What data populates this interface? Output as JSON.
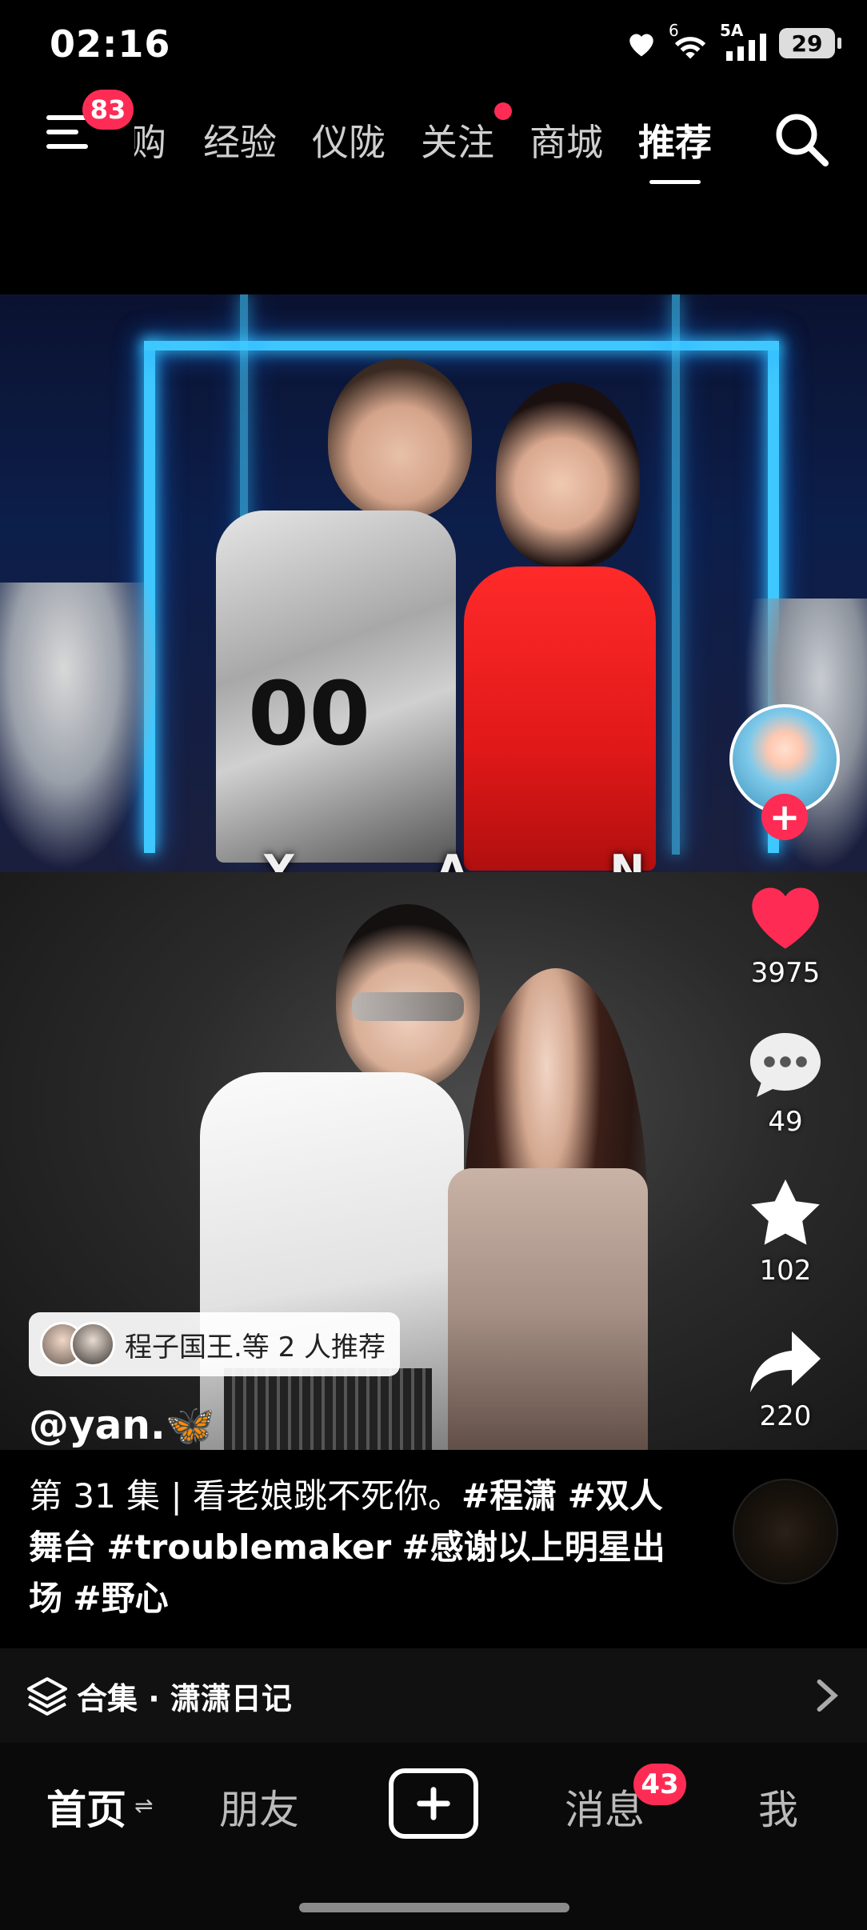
{
  "status_bar": {
    "time": "02:16",
    "network_small": "6",
    "network_type": "5A",
    "battery": "29"
  },
  "top_nav": {
    "menu_badge": "83",
    "tabs": [
      {
        "label": "购",
        "active": false
      },
      {
        "label": "经验",
        "active": false
      },
      {
        "label": "仪陇",
        "active": false
      },
      {
        "label": "关注",
        "active": false,
        "dot": true
      },
      {
        "label": "商城",
        "active": false
      },
      {
        "label": "推荐",
        "active": true
      }
    ]
  },
  "video": {
    "overlay_letters": [
      "Y",
      "A",
      "N"
    ]
  },
  "actions": {
    "like_count": "3975",
    "comment_count": "49",
    "favorite_count": "102",
    "share_count": "220"
  },
  "recommend": {
    "text": "程子国王.等 2 人推荐"
  },
  "author": {
    "username": "@yan.🦋"
  },
  "caption": {
    "lead": "第 31 集 | 看老娘跳不死你。",
    "tags": [
      "#程潇",
      "#双人舞台",
      "#troublemaker",
      "#感谢以上明星出场",
      "#野心"
    ]
  },
  "collection": {
    "label": "合集 · 潇潇日记"
  },
  "bottom_nav": {
    "home": "首页",
    "home_switch": "⇌",
    "friends": "朋友",
    "messages": "消息",
    "messages_badge": "43",
    "me": "我"
  },
  "colors": {
    "accent": "#fe2c55",
    "background": "#000000"
  }
}
